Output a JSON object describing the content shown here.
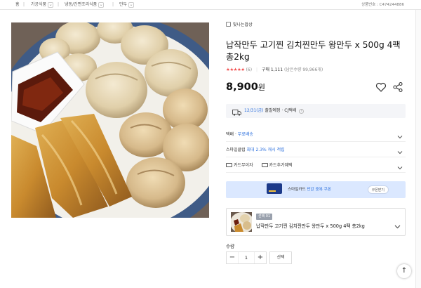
{
  "breadcrumb": {
    "home": "홈",
    "items": [
      "가공식품",
      "냉동/간편조리식품",
      "만두"
    ]
  },
  "product_no": "상품번호 : C474244886",
  "seller": "빛나는밥상",
  "title": "납작만두 고기찐 김치찐만두 왕만두 x 500g 4팩 총2kg",
  "rating": {
    "stars": "★★★★★",
    "count": "(6)",
    "purchases": "구매 1,111",
    "stock": "(남은수량 99,966개)"
  },
  "price": {
    "amount": "8,900",
    "unit": "원"
  },
  "shipping": {
    "date": "12/31(금)",
    "status": "출발예정",
    "carrier": "· CJ택배",
    "help": "?"
  },
  "delivery_row": {
    "label": "택배 ·",
    "value": "무료배송"
  },
  "smile_row": {
    "label": "스마일클럽",
    "value": "최대 2.3% 캐시 적립"
  },
  "payment_row": {
    "card_installment": "카드무이자",
    "card_benefit": "카드추가혜택"
  },
  "banner": {
    "text_prefix": "스마일카드",
    "text_highlight": "반값 중복 쿠폰",
    "button": "쿠폰받기"
  },
  "option": {
    "badge": "선택 01",
    "label": "납작만두 고기찐 김치찐만두 왕만두 x 500g 4팩 총2kg"
  },
  "quantity": {
    "label": "수량",
    "minus": "−",
    "value": "1",
    "plus": "+",
    "select": "선택"
  },
  "top_button": "↑",
  "colors": {
    "accent_blue": "#2b6fdd",
    "star_red": "#f24f4f",
    "banner_bg": "#dbe8ff"
  }
}
